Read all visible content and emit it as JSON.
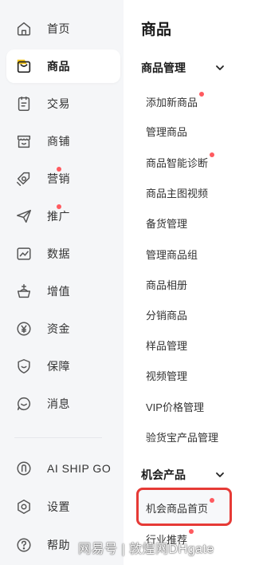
{
  "nav": {
    "items": [
      {
        "label": "首页",
        "icon": "home-icon"
      },
      {
        "label": "商品",
        "icon": "product-bag-icon",
        "active": true
      },
      {
        "label": "交易",
        "icon": "order-icon"
      },
      {
        "label": "商铺",
        "icon": "store-icon"
      },
      {
        "label": "营销",
        "icon": "marketing-icon",
        "badge": true
      },
      {
        "label": "推广",
        "icon": "promotion-icon",
        "badge": true
      },
      {
        "label": "数据",
        "icon": "chart-icon"
      },
      {
        "label": "增值",
        "icon": "value-added-icon"
      },
      {
        "label": "资金",
        "icon": "yuan-icon"
      },
      {
        "label": "保障",
        "icon": "shield-icon"
      },
      {
        "label": "消息",
        "icon": "message-icon"
      }
    ],
    "bottom": [
      {
        "label": "AI SHIP GO",
        "icon": "ai-ship-icon"
      },
      {
        "label": "设置",
        "icon": "settings-icon"
      },
      {
        "label": "帮助",
        "icon": "help-icon"
      }
    ]
  },
  "panel": {
    "title": "商品",
    "groups": [
      {
        "title": "商品管理",
        "items": [
          {
            "label": "添加新商品",
            "badge": true
          },
          {
            "label": "管理商品"
          },
          {
            "label": "商品智能诊断",
            "badge": true
          },
          {
            "label": "商品主图视频"
          },
          {
            "label": "备货管理"
          },
          {
            "label": "管理商品组"
          },
          {
            "label": "商品相册"
          },
          {
            "label": "分销商品"
          },
          {
            "label": "样品管理"
          },
          {
            "label": "视频管理"
          },
          {
            "label": "VIP价格管理"
          },
          {
            "label": "验货宝产品管理"
          }
        ]
      },
      {
        "title": "机会产品",
        "items": [
          {
            "label": "机会商品首页",
            "badge": true,
            "highlighted": true
          },
          {
            "label": "行业推荐",
            "badge": true
          }
        ]
      }
    ]
  },
  "watermark": "网易号 | 敦煌网DHgate",
  "colors": {
    "rail_bg": "#f5f6f8",
    "badge_red": "#ff5a5f",
    "highlight_border": "#e63a36",
    "active_icon_accent": "#f5c518"
  }
}
